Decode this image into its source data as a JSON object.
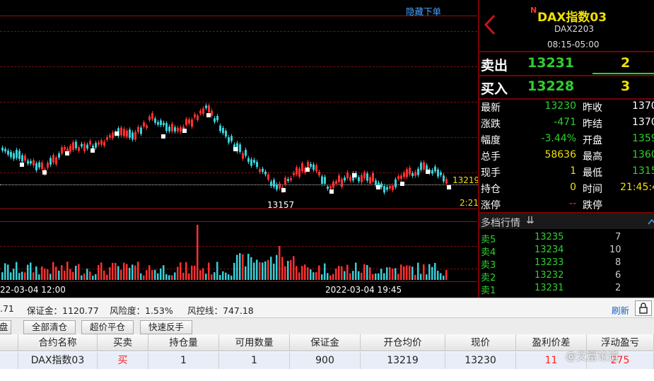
{
  "chart": {
    "hide_orders_label": "隐藏下单",
    "last_price_label": "13219",
    "low_label": "13157",
    "time_label": "2:21",
    "x_tick_left": "22-03-04 12:00",
    "x_tick_right": "2022-03-04 19:45"
  },
  "quote": {
    "title": "DAX指数03",
    "title_marker": "N",
    "code": "DAX2203",
    "session": "08:15-05:00",
    "sell_label": "卖出",
    "sell_price": "13231",
    "sell_qty": "2",
    "buy_label": "买入",
    "buy_price": "13228",
    "buy_qty": "3",
    "rows": [
      {
        "l1": "最新",
        "v1": "13230",
        "l2": "昨收",
        "v2": "1370"
      },
      {
        "l1": "涨跌",
        "v1": "-471",
        "l2": "昨结",
        "v2": "1370"
      },
      {
        "l1": "幅度",
        "v1": "-3.44%",
        "l2": "开盘",
        "v2": "1359"
      },
      {
        "l1": "总手",
        "v1": "58636",
        "l2": "最高",
        "v2": "1360"
      },
      {
        "l1": "现手",
        "v1": "1",
        "l2": "最低",
        "v2": "1315"
      },
      {
        "l1": "持仓",
        "v1": "0",
        "l2": "时间",
        "v2": "21:45:4"
      },
      {
        "l1": "涨停",
        "v1": "--",
        "l2": "跌停",
        "v2": ""
      }
    ],
    "depth_title": "多档行情",
    "depth": [
      {
        "label": "卖5",
        "price": "13235",
        "qty": "7"
      },
      {
        "label": "卖4",
        "price": "13234",
        "qty": "10"
      },
      {
        "label": "卖3",
        "price": "13233",
        "qty": "8"
      },
      {
        "label": "卖2",
        "price": "13232",
        "qty": "6"
      },
      {
        "label": "卖1",
        "price": "13231",
        "qty": "2"
      }
    ]
  },
  "account": {
    "balance_fragment": ".71",
    "margin": "保证金：1120.77",
    "risk": "风险度：1.53%",
    "risk_line": "风控线：747.18",
    "refresh": "刷新"
  },
  "buttons": {
    "partial": "盘",
    "close_all": "全部清仓",
    "super_close": "超价平仓",
    "quick_reverse": "快速反手"
  },
  "table": {
    "headers": [
      "合约名称",
      "买卖",
      "持仓量",
      "可用数量",
      "保证金",
      "开仓均价",
      "现价",
      "盈利价差",
      "浮动盈亏"
    ],
    "row": [
      "DAX指数03",
      "买",
      "1",
      "1",
      "900",
      "13219",
      "13230",
      "11",
      "275"
    ]
  },
  "watermark": "@文富论道",
  "colors": {
    "up": "#ff3030",
    "down": "#38d0d8",
    "price": "#2fd02f",
    "accent": "#f0e000"
  }
}
